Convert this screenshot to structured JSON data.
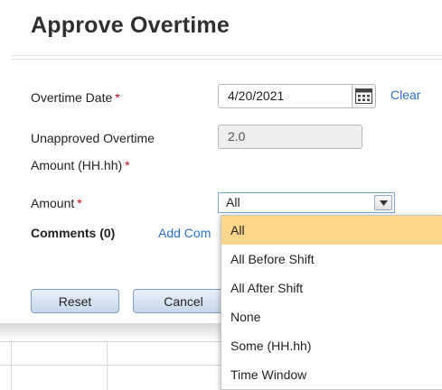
{
  "dialog": {
    "title": "Approve Overtime"
  },
  "form": {
    "overtime_date": {
      "label": "Overtime Date",
      "required_mark": "*",
      "value": "4/20/2021",
      "clear_label": "Clear"
    },
    "unapproved_amount": {
      "label_line1": "Unapproved Overtime",
      "label_line2": "Amount (HH.hh)",
      "required_mark": "*",
      "value": "2.0"
    },
    "amount": {
      "label": "Amount",
      "required_mark": "*",
      "selected": "All",
      "options": [
        "All",
        "All Before Shift",
        "All After Shift",
        "None",
        "Some (HH.hh)",
        "Time Window"
      ]
    },
    "comments": {
      "label": "Comments (0)",
      "add_label": "Add Com"
    }
  },
  "buttons": {
    "reset_label": "Reset",
    "cancel_label": "Cancel"
  },
  "icons": {
    "calendar": "calendar-icon",
    "dropdown_arrow": "chevron-down-icon"
  },
  "colors": {
    "link": "#2a6fc9",
    "required": "#d0021b",
    "highlight": "#fcd68b"
  }
}
